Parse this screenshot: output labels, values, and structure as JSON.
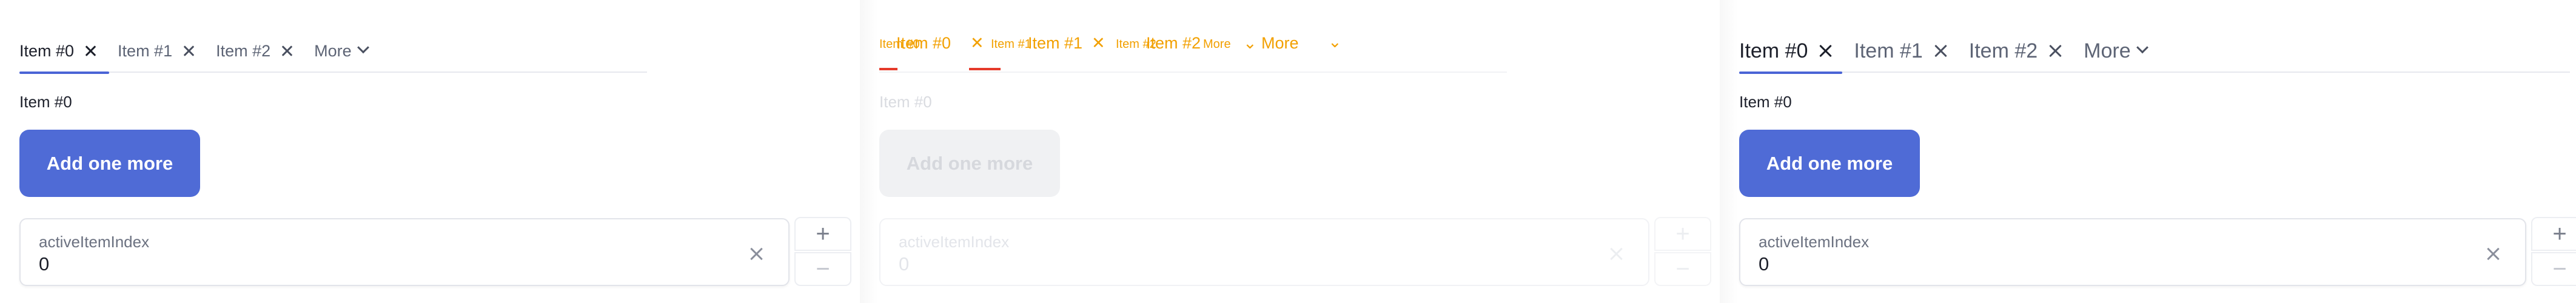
{
  "tabs": {
    "items": [
      {
        "label": "Item #0",
        "active": true
      },
      {
        "label": "Item #1",
        "active": false
      },
      {
        "label": "Item #2",
        "active": false
      }
    ],
    "more_label": "More"
  },
  "content": {
    "section_label": "Item #0",
    "add_button_label": "Add one more"
  },
  "field": {
    "label": "activeItemIndex",
    "value": "0"
  },
  "stepper": {
    "plus": "+",
    "minus": "−"
  },
  "colors": {
    "accent": "#4f6bd6",
    "underline": "#4a64d6",
    "glitch_orange": "#f2a000",
    "glitch_red": "#e53a2a"
  }
}
